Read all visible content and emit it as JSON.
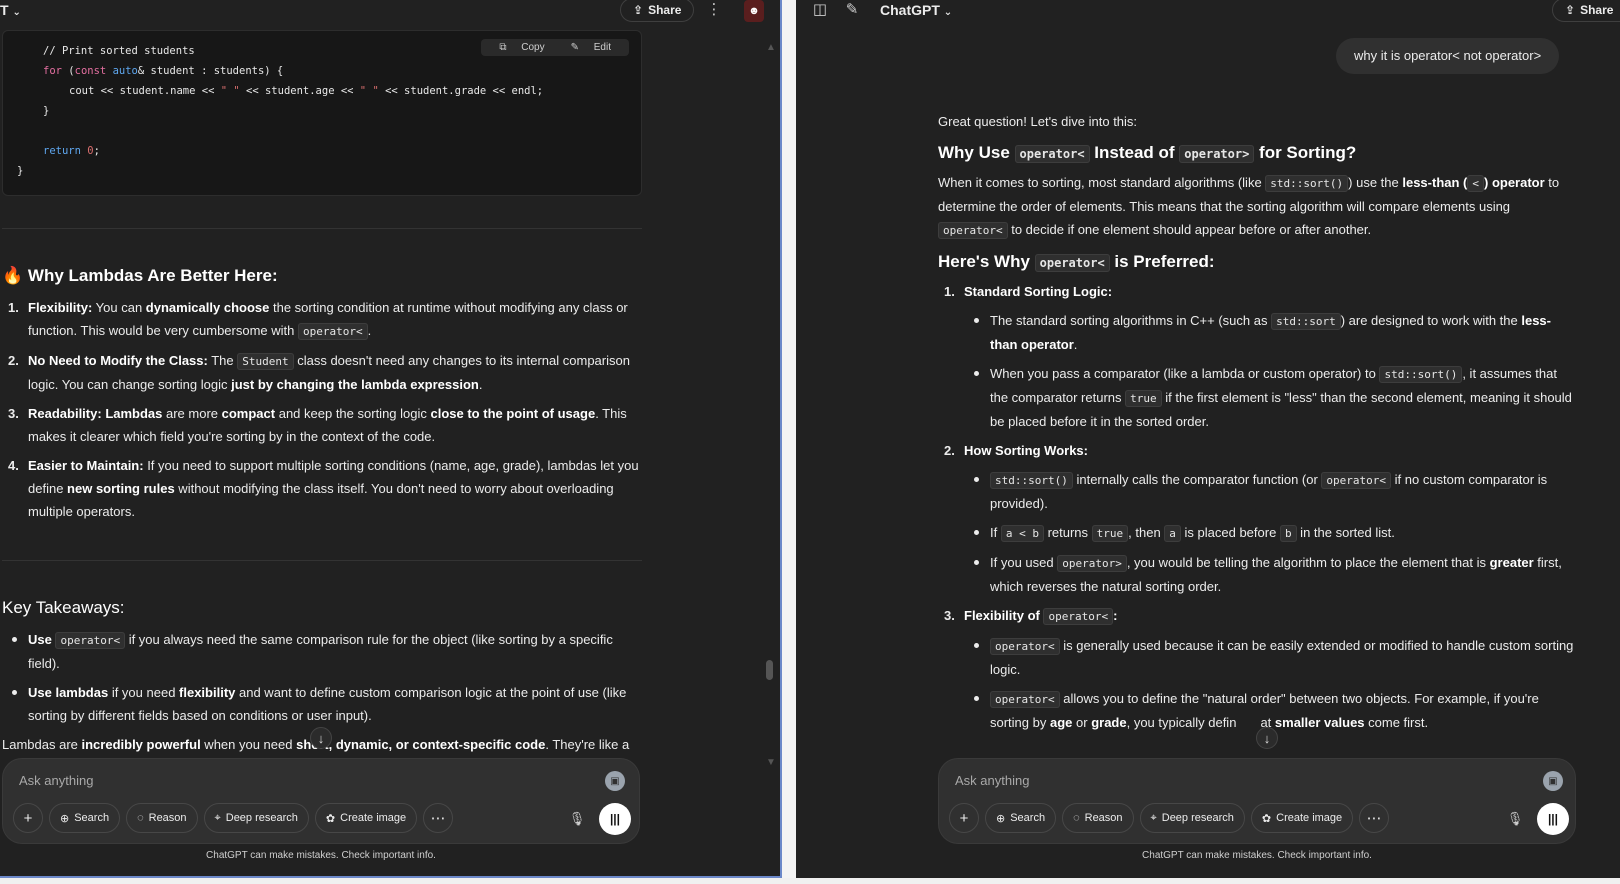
{
  "left": {
    "top": {
      "corner_label": "T",
      "share": "Share"
    },
    "code": {
      "copy": "Copy",
      "edit": "Edit",
      "comment": "// Print sorted students",
      "for_kw": "for",
      "for_paren": " (",
      "const_kw": "const",
      "auto_kw": "auto",
      "for_rest": "& student : students) {",
      "cout_a": "cout << student.name << ",
      "str1": "\" \"",
      "cout_b": " << student.age << ",
      "str2": "\" \"",
      "cout_c": " << student.grade << endl;",
      "close_inner": "}",
      "return_kw": "return",
      "return_val": "0",
      "return_end": ";",
      "close_outer": "}"
    },
    "section1": {
      "emoji": "🔥",
      "title": "Why Lambdas Are Better Here:",
      "items": [
        {
          "n": "1.",
          "t1": "Flexibility:",
          "t2": " You can ",
          "t3": "dynamically choose",
          "t4": " the sorting condition at runtime without modifying any class or function. This would be very cumbersome with ",
          "code": "operator<",
          "t5": "."
        },
        {
          "n": "2.",
          "t1": "No Need to Modify the Class:",
          "t2": " The ",
          "code": "Student",
          "t3": " class doesn't need any changes to its internal comparison logic. You can change sorting logic ",
          "t4": "just by changing the lambda expression",
          "t5": "."
        },
        {
          "n": "3.",
          "t1": "Readability:",
          "t2": " ",
          "t3": "Lambdas",
          "t4": " are more ",
          "t5": "compact",
          "t6": " and keep the sorting logic ",
          "t7": "close to the point of usage",
          "t8": ". This makes it clearer which field you're sorting by in the context of the code."
        },
        {
          "n": "4.",
          "t1": "Easier to Maintain:",
          "t2": " If you need to support multiple sorting conditions (name, age, grade), lambdas let you define ",
          "t3": "new sorting rules",
          "t4": " without modifying the class itself. You don't need to worry about overloading multiple operators."
        }
      ]
    },
    "section2": {
      "title": "Key Takeaways:",
      "items": [
        {
          "t1": "Use ",
          "code": "operator<",
          "t2": " if you always need the same comparison rule for the object (like sorting by a specific field)."
        },
        {
          "t1": "Use lambdas",
          "t2": " if you need ",
          "t3": "flexibility",
          "t4": " and want to define custom comparison logic at the point of use (like sorting by different fields based on conditions or user input)."
        }
      ],
      "closing_1": "Lambdas are ",
      "closing_2": "incredibly powerful",
      "closing_3": " when you need ",
      "closing_4": "short, dynamic, or context-specific code",
      "closing_5": ". They're like a"
    },
    "composer": {
      "placeholder": "Ask anything",
      "tools": [
        "Search",
        "Reason",
        "Deep research",
        "Create image"
      ],
      "footnote": "ChatGPT can make mistakes. Check important info."
    }
  },
  "right": {
    "top": {
      "model": "ChatGPT",
      "share": "Share"
    },
    "user_message": "why it is operator<  not operator>",
    "intro": "Great question! Let's dive into this:",
    "h1": {
      "a": "Why Use ",
      "code1": "operator<",
      "b": " Instead of ",
      "code2": "operator>",
      "c": " for Sorting?"
    },
    "p1": {
      "a": "When it comes to sorting, most standard algorithms (like ",
      "code1": "std::sort()",
      "b": ") use the ",
      "c": "less-than (",
      "code2": "<",
      "d": ") operator",
      "e": " to determine the order of elements. This means that the sorting algorithm will compare elements using ",
      "code3": "operator<",
      "f": " to decide if one element should appear before or after another."
    },
    "h2": {
      "a": "Here's Why ",
      "code": "operator<",
      "b": " is Preferred:"
    },
    "sections": [
      {
        "n": "1.",
        "title": "Standard Sorting Logic:",
        "bullets": [
          {
            "a": "The standard sorting algorithms in C++ (such as ",
            "code": "std::sort",
            "b": ") are designed to work with the ",
            "c": "less-than operator",
            "d": "."
          },
          {
            "a": "When you pass a comparator (like a lambda or custom operator) to ",
            "code": "std::sort()",
            "b": ", it assumes that the comparator returns ",
            "code2": "true",
            "c": " if the first element is \"less\" than the second element, meaning it should be placed before it in the sorted order."
          }
        ]
      },
      {
        "n": "2.",
        "title": "How Sorting Works:",
        "bullets": [
          {
            "code": "std::sort()",
            "a": " internally calls the comparator function (or ",
            "code2": "operator<",
            "b": " if no custom comparator is provided)."
          },
          {
            "a": "If ",
            "code": "a < b",
            "b": " returns ",
            "code2": "true",
            "c": ", then ",
            "code3": "a",
            "d": " is placed before ",
            "code4": "b",
            "e": " in the sorted list."
          },
          {
            "a": "If you used ",
            "code": "operator>",
            "b": ", you would be telling the algorithm to place the element that is ",
            "c": "greater",
            "d": " first, which reverses the natural sorting order."
          }
        ]
      },
      {
        "n": "3.",
        "title": "Flexibility of ",
        "title_code": "operator<",
        "title_end": ":",
        "bullets": [
          {
            "code": "operator<",
            "a": " is generally used because it can be easily extended or modified to handle custom sorting logic."
          },
          {
            "code": "operator<",
            "a": " allows you to define the \"natural order\" between two objects. For example, if you're sorting by ",
            "b": "age",
            "c": " or ",
            "d": "grade",
            "e": ", you typically defin",
            "f": "at ",
            "g": "smaller values",
            "h": " come first."
          }
        ]
      }
    ],
    "composer": {
      "placeholder": "Ask anything",
      "tools": [
        "Search",
        "Reason",
        "Deep research",
        "Create image"
      ],
      "footnote": "ChatGPT can make mistakes. Check important info."
    }
  }
}
